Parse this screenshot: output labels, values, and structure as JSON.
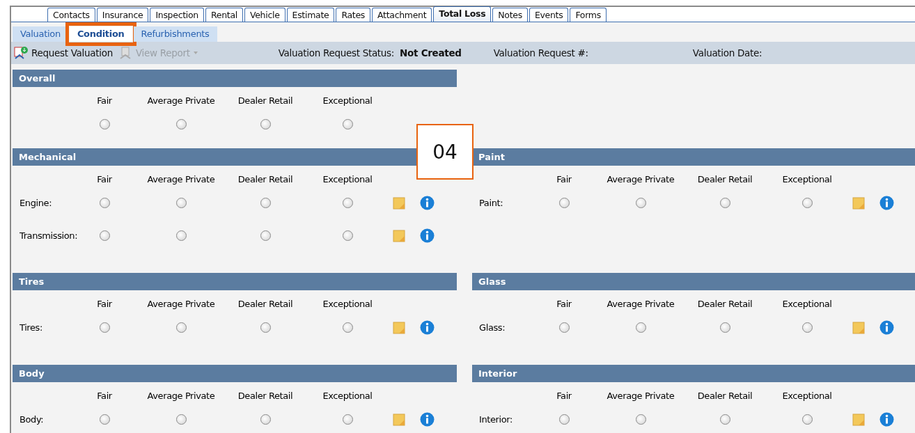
{
  "tabs": [
    {
      "label": "Contacts",
      "selected": false
    },
    {
      "label": "Insurance",
      "selected": false
    },
    {
      "label": "Inspection",
      "selected": false
    },
    {
      "label": "Rental",
      "selected": false
    },
    {
      "label": "Vehicle",
      "selected": false
    },
    {
      "label": "Estimate",
      "selected": false
    },
    {
      "label": "Rates",
      "selected": false
    },
    {
      "label": "Attachment",
      "selected": false
    },
    {
      "label": "Total Loss",
      "selected": true
    },
    {
      "label": "Notes",
      "selected": false
    },
    {
      "label": "Events",
      "selected": false
    },
    {
      "label": "Forms",
      "selected": false
    }
  ],
  "subtabs": [
    {
      "label": "Valuation",
      "selected": false,
      "highlighted": false
    },
    {
      "label": "Condition",
      "selected": true,
      "highlighted": true
    },
    {
      "label": "Refurbishments",
      "selected": false,
      "highlighted": false
    }
  ],
  "toolbar": {
    "request_valuation": {
      "label": "Request Valuation",
      "disabled": false
    },
    "view_report": {
      "label": "View Report",
      "disabled": true
    },
    "status_label": "Valuation Request Status:",
    "status_value": "Not Created",
    "request_number_label": "Valuation Request #:",
    "date_label": "Valuation Date:"
  },
  "overall": {
    "title": "Overall",
    "options": [
      "Fair",
      "Average Private",
      "Dealer Retail",
      "Exceptional"
    ],
    "choices": [
      {
        "selected": false
      },
      {
        "selected": false
      },
      {
        "selected": false
      },
      {
        "selected": false
      }
    ]
  },
  "sections": [
    {
      "title": "Mechanical",
      "options": [
        "Fair",
        "Average Private",
        "Dealer Retail",
        "Exceptional"
      ],
      "rows": [
        {
          "label": "Engine:",
          "choices": [
            {
              "selected": false
            },
            {
              "selected": false
            },
            {
              "selected": false
            },
            {
              "selected": false
            }
          ]
        },
        {
          "label": "Transmission:",
          "choices": [
            {
              "selected": false
            },
            {
              "selected": false
            },
            {
              "selected": false
            },
            {
              "selected": false
            }
          ]
        }
      ]
    },
    {
      "title": "Paint",
      "options": [
        "Fair",
        "Average Private",
        "Dealer Retail",
        "Exceptional"
      ],
      "rows": [
        {
          "label": "Paint:",
          "choices": [
            {
              "selected": false
            },
            {
              "selected": false
            },
            {
              "selected": false
            },
            {
              "selected": false
            }
          ]
        }
      ]
    },
    {
      "title": "Tires",
      "options": [
        "Fair",
        "Average Private",
        "Dealer Retail",
        "Exceptional"
      ],
      "rows": [
        {
          "label": "Tires:",
          "choices": [
            {
              "selected": false
            },
            {
              "selected": false
            },
            {
              "selected": false
            },
            {
              "selected": false
            }
          ]
        }
      ]
    },
    {
      "title": "Glass",
      "options": [
        "Fair",
        "Average Private",
        "Dealer Retail",
        "Exceptional"
      ],
      "rows": [
        {
          "label": "Glass:",
          "choices": [
            {
              "selected": false
            },
            {
              "selected": false
            },
            {
              "selected": false
            },
            {
              "selected": false
            }
          ]
        }
      ]
    },
    {
      "title": "Body",
      "options": [
        "Fair",
        "Average Private",
        "Dealer Retail",
        "Exceptional"
      ],
      "rows": [
        {
          "label": "Body:",
          "choices": [
            {
              "selected": false
            },
            {
              "selected": false
            },
            {
              "selected": false
            },
            {
              "selected": false
            }
          ]
        }
      ]
    },
    {
      "title": "Interior",
      "options": [
        "Fair",
        "Average Private",
        "Dealer Retail",
        "Exceptional"
      ],
      "rows": [
        {
          "label": "Interior:",
          "choices": [
            {
              "selected": false
            },
            {
              "selected": false
            },
            {
              "selected": false
            },
            {
              "selected": false
            }
          ]
        }
      ]
    }
  ],
  "callout": {
    "text": "04"
  }
}
